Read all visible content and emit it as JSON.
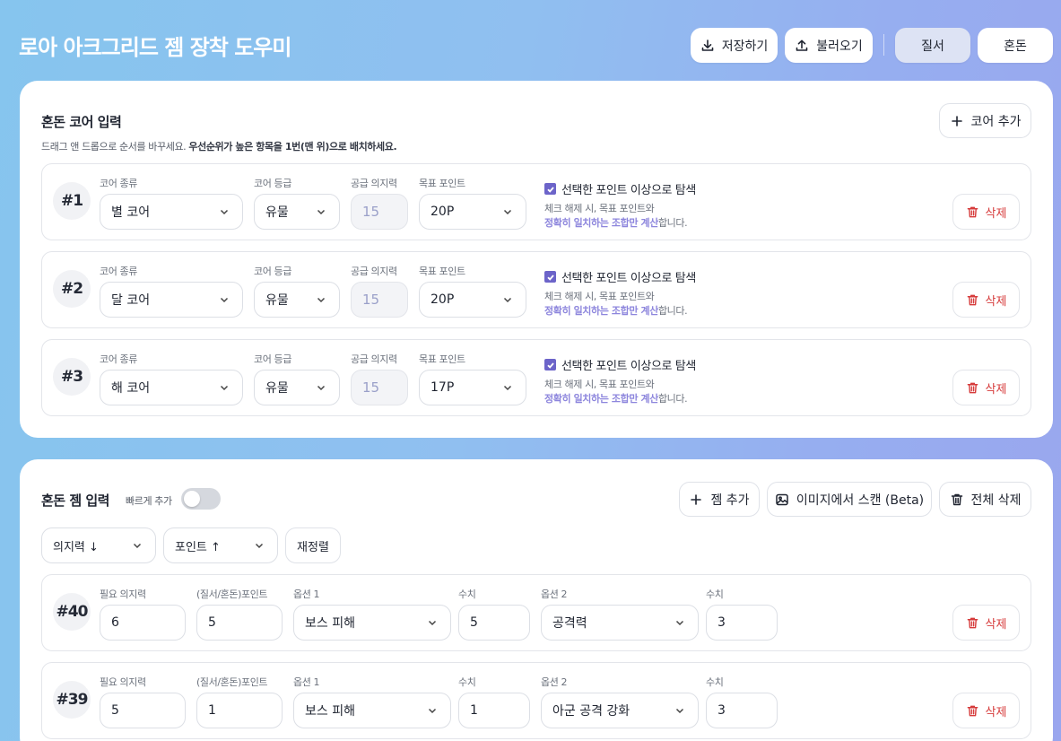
{
  "header": {
    "title": "로아 아크그리드 젬 장착 도우미",
    "save_label": "저장하기",
    "load_label": "불러오기",
    "tabs": [
      {
        "label": "질서",
        "active": true
      },
      {
        "label": "혼돈",
        "active": false
      }
    ]
  },
  "core_section": {
    "title": "혼돈 코어 입력",
    "hint_normal": "드래그 앤 드롭으로 순서를 바꾸세요. ",
    "hint_bold": "우선순위가 높은 항목을 1번(맨 위)으로 배치하세요.",
    "add_label": "코어 추가",
    "labels": {
      "core_type": "코어 종류",
      "core_grade": "코어 등급",
      "supply_will": "공급 의지력",
      "target_point": "목표 포인트"
    },
    "checkbox_label": "선택한 포인트 이상으로 탐색",
    "note_line1": "체크 해제 시, 목표 포인트와",
    "note_line2_bold": "정확히 일치하는 조합만 계산",
    "note_line2_rest": "합니다.",
    "delete_label": "삭제",
    "rows": [
      {
        "num": "#1",
        "type": "별 코어",
        "grade": "유물",
        "supply": "15",
        "target": "20P",
        "checked": true
      },
      {
        "num": "#2",
        "type": "달 코어",
        "grade": "유물",
        "supply": "15",
        "target": "20P",
        "checked": true
      },
      {
        "num": "#3",
        "type": "해 코어",
        "grade": "유물",
        "supply": "15",
        "target": "17P",
        "checked": true
      }
    ]
  },
  "gem_section": {
    "title": "혼돈 젬 입력",
    "quick_add_label": "빠르게 추가",
    "quick_add_on": false,
    "add_label": "젬 추가",
    "scan_label": "이미지에서 스캔 (Beta)",
    "delete_all_label": "전체 삭제",
    "sort1": "의지력 ↓",
    "sort2": "포인트 ↑",
    "resort_label": "재정렬",
    "labels": {
      "req_will": "필요 의지력",
      "points": "(질서/혼돈)포인트",
      "option1": "옵션 1",
      "value": "수치",
      "option2": "옵션 2"
    },
    "delete_label": "삭제",
    "rows": [
      {
        "num": "#40",
        "req_will": "6",
        "points": "5",
        "option1": "보스 피해",
        "value1": "5",
        "option2": "공격력",
        "value2": "3"
      },
      {
        "num": "#39",
        "req_will": "5",
        "points": "1",
        "option1": "보스 피해",
        "value1": "1",
        "option2": "아군 공격 강화",
        "value2": "3"
      }
    ]
  }
}
